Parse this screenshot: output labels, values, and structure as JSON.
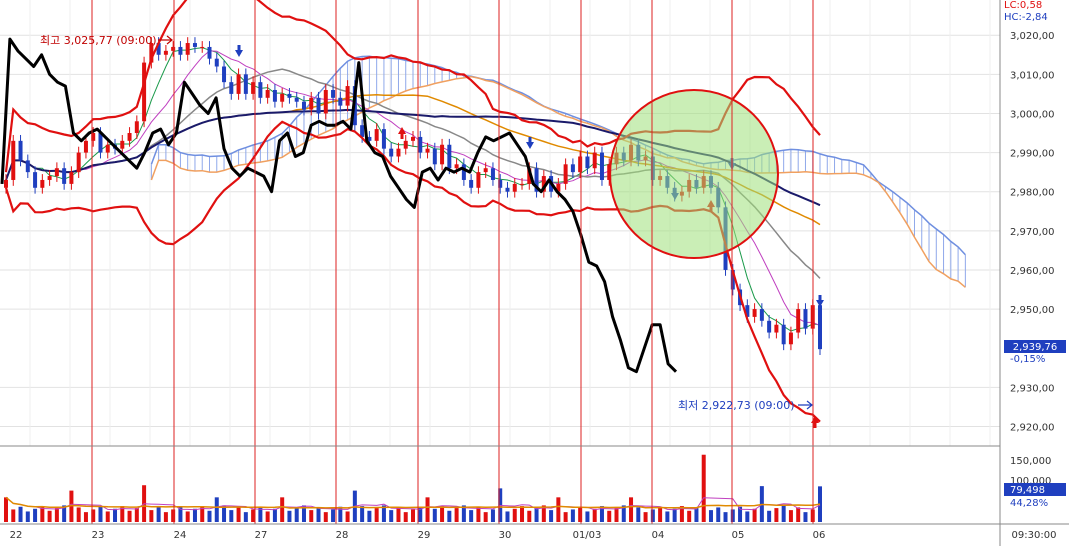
{
  "header": {
    "lc_label": "LC:0,58",
    "hc_label": "HC:-2,84"
  },
  "price_axis": {
    "ticks": [
      "3,020,00",
      "3,010,00",
      "3,000,00",
      "2,990,00",
      "2,980,00",
      "2,970,00",
      "2,960,00",
      "2,950,00",
      "2,930,00",
      "2,920,00"
    ],
    "tick_values": [
      3020,
      3010,
      3000,
      2990,
      2980,
      2970,
      2960,
      2950,
      2930,
      2920
    ],
    "current_price": "2,939,76",
    "change_pct": "-0,15%"
  },
  "volume_axis": {
    "ticks": [
      "150,000",
      "100,000"
    ],
    "current_volume": "79,498",
    "volume_pct": "44,28%"
  },
  "annotations": {
    "high_label": "최고 3,025,77 (09:00)",
    "low_label": "최저 2,922,73 (09:00)"
  },
  "time_axis": {
    "labels": [
      "22",
      "23",
      "24",
      "27",
      "28",
      "29",
      "30",
      "01/03",
      "04",
      "05",
      "06"
    ],
    "current_time": "09:30:00"
  },
  "colors": {
    "candle_up": "#e01010",
    "candle_down": "#1f3fbf",
    "bollinger": "#e01010",
    "overlay_line": "#000000",
    "cloud_top": "#6f8fe0",
    "cloud_bottom": "#f0a060",
    "highlight_fill": "#9fe07a"
  },
  "chart_data": {
    "type": "candlestick",
    "ylim": [
      2915,
      3029
    ],
    "volume_ylim": [
      0,
      165000
    ],
    "days": [
      "22",
      "23",
      "24",
      "27",
      "28",
      "29",
      "30",
      "01/03",
      "04",
      "05",
      "06"
    ],
    "high": 3025.77,
    "low": 2922.73,
    "last": 2939.76,
    "last_change_pct": -0.15,
    "last_volume": 79498,
    "overlay_close": [
      2982,
      3019,
      3016,
      3014,
      3012,
      3015,
      3010,
      3008,
      3007,
      2995,
      2993,
      2995,
      2996,
      2994,
      2992,
      2990,
      2988,
      2986,
      2990,
      2995,
      2996,
      2992,
      2995,
      3008,
      3005,
      3002,
      3000,
      3004,
      2991,
      2986,
      2984,
      2986,
      2985,
      2984,
      2980,
      2993,
      2995,
      2989,
      2990,
      2997,
      2998,
      2997,
      2997,
      2998,
      2996,
      3013,
      2993,
      2990,
      2989,
      2984,
      2981,
      2978,
      2976,
      2985,
      2986,
      2983,
      2986,
      2985,
      2986,
      2985,
      2990,
      2994,
      2993,
      2994,
      2995,
      2992,
      2989,
      2982,
      2980,
      2983,
      2980,
      2978,
      2975,
      2969,
      2962,
      2961,
      2957,
      2948,
      2942,
      2935,
      2934,
      2940,
      2946,
      2946,
      2936,
      2934
    ],
    "candle_close": [
      2983,
      2993,
      2988,
      2985,
      2981,
      2983,
      2984,
      2986,
      2982,
      2985,
      2990,
      2993,
      2995,
      2990,
      2992,
      2991,
      2993,
      2995,
      2998,
      3013,
      3018,
      3015,
      3016,
      3017,
      3015,
      3018,
      3017,
      3017,
      3014,
      3012,
      3008,
      3005,
      3010,
      3005,
      3008,
      3004,
      3006,
      3003,
      3005,
      3004,
      3003,
      3001,
      3004,
      3000,
      3006,
      3004,
      3002,
      3007,
      2997,
      2994,
      2993,
      2996,
      2991,
      2989,
      2991,
      2993,
      2994,
      2990,
      2991,
      2987,
      2992,
      2986,
      2987,
      2983,
      2981,
      2985,
      2986,
      2983,
      2981,
      2980,
      2982,
      2982,
      2986,
      2980,
      2984,
      2980,
      2982,
      2987,
      2985,
      2989,
      2986,
      2990,
      2983,
      2987,
      2990,
      2988,
      2992,
      2988,
      2989,
      2983,
      2984,
      2981,
      2979,
      2980,
      2983,
      2981,
      2984,
      2981,
      2976,
      2960,
      2955,
      2951,
      2948,
      2950,
      2947,
      2944,
      2946,
      2941,
      2944,
      2950,
      2945,
      2951,
      2939.76
    ]
  }
}
